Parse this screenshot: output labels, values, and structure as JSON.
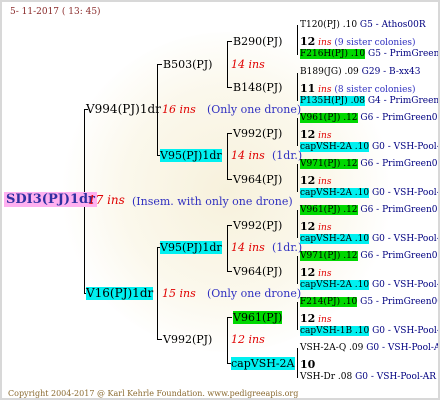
{
  "date": "5- 11-2017 ( 13: 45)",
  "root": {
    "label": "SDI3(PJ)1dr",
    "ins": "17 ins",
    "note": "(Insem. with only one drone)"
  },
  "gen1": [
    {
      "label": "V994(PJ)1dr",
      "ins": "16 ins",
      "note": "(Only one drone)"
    },
    {
      "label": "V16(PJ)1dr",
      "ins": "15 ins",
      "note": "(Only one drone)"
    }
  ],
  "gen2": [
    {
      "label": "B503(PJ)",
      "ins": "14 ins"
    },
    {
      "label": "V95(PJ)1dr",
      "ins": "14 ins",
      "note": "(1dr.)"
    },
    {
      "label": "V95(PJ)1dr",
      "ins": "14 ins",
      "note": "(1dr.)"
    },
    {
      "label": "V992(PJ)",
      "ins": "12 ins"
    }
  ],
  "gen3": [
    {
      "label": "B290(PJ)"
    },
    {
      "label": "B148(PJ)"
    },
    {
      "label": "V992(PJ)"
    },
    {
      "label": "V964(PJ)"
    },
    {
      "label": "V992(PJ)"
    },
    {
      "label": "V964(PJ)"
    },
    {
      "label": "V961(PJ)"
    },
    {
      "label": "capVSH-2A"
    }
  ],
  "gen4": [
    {
      "label": "T120(PJ) .10",
      "right": "G5 - Athos00R"
    },
    {
      "label": "12 ins",
      "note": "(9 sister colonies)"
    },
    {
      "label": "F216H(PJ) .10",
      "right": "G5 - PrimGreen00"
    },
    {
      "label": "B189(JG) .09",
      "right": "G29 - B-xx43"
    },
    {
      "label": "11 ins",
      "note": "(8 sister colonies)"
    },
    {
      "label": "P135H(PJ) .08",
      "right": "G4 - PrimGreen00"
    },
    {
      "label": "V961(PJ) .12",
      "right": "G6 - PrimGreen00"
    },
    {
      "label": "12 ins"
    },
    {
      "label": "capVSH-2A .10",
      "right": "G0 - VSH-Pool-AR"
    },
    {
      "label": "V971(PJ) .12",
      "right": "G6 - PrimGreen00"
    },
    {
      "label": "12 ins"
    },
    {
      "label": "capVSH-2A .10",
      "right": "G0 - VSH-Pool-AR"
    },
    {
      "label": "V961(PJ) .12",
      "right": "G6 - PrimGreen00"
    },
    {
      "label": "12 ins"
    },
    {
      "label": "capVSH-2A .10",
      "right": "G0 - VSH-Pool-AR"
    },
    {
      "label": "V971(PJ) .12",
      "right": "G6 - PrimGreen00"
    },
    {
      "label": "12 ins"
    },
    {
      "label": "capVSH-2A .10",
      "right": "G0 - VSH-Pool-AR"
    },
    {
      "label": "F214(PJ) .10",
      "right": "G5 - PrimGreen00"
    },
    {
      "label": "12 ins"
    },
    {
      "label": "capVSH-1B .10",
      "right": "G0 - VSH-Pool-AR"
    },
    {
      "label": "VSH-2A-Q .09",
      "right": "G0 - VSH-Pool-AR"
    },
    {
      "label": "10"
    },
    {
      "label": "VSH-Dr .08",
      "right": "G0 - VSH-Pool-AR"
    }
  ],
  "footer": "Copyright 2004-2017 @ Karl Kehrle Foundation.   www.pedigreeapis.org"
}
